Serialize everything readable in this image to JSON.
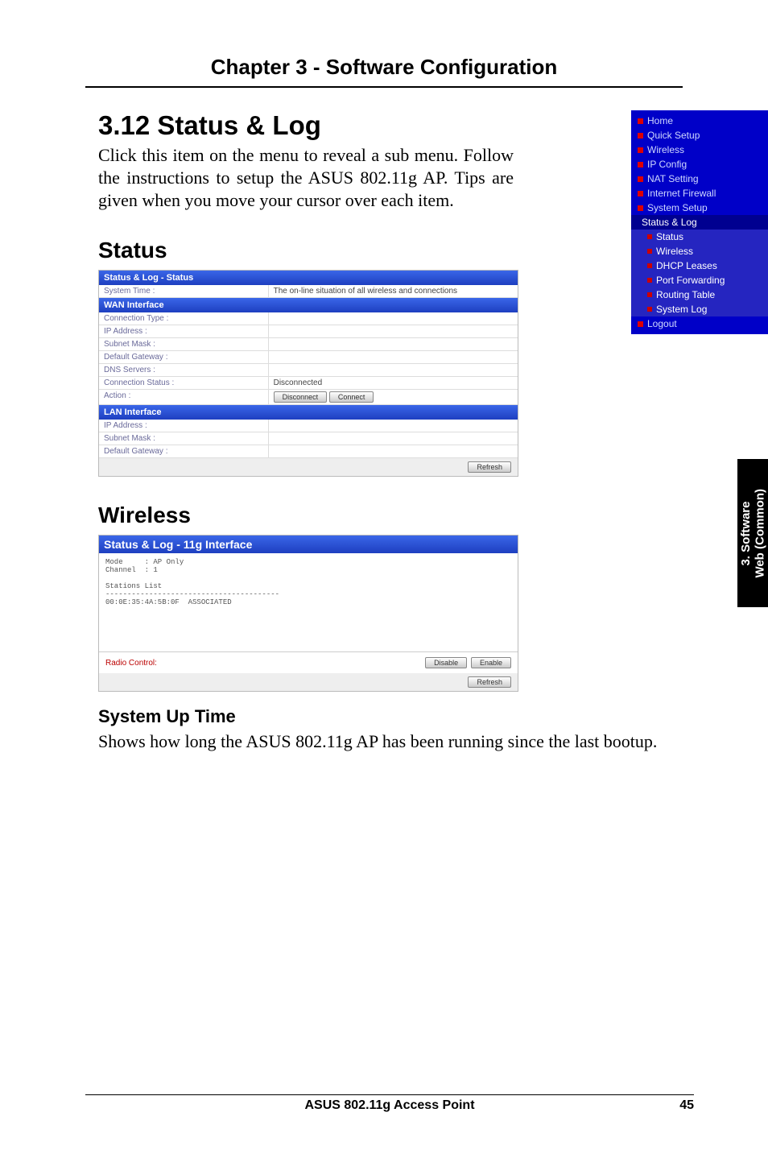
{
  "chapter_title": "Chapter 3 - Software Configuration",
  "section_title": "3.12  Status & Log",
  "intro": "Click this item on the menu to reveal a sub menu. Follow the instructions to setup the ASUS 802.11g AP. Tips are given when you move your cursor over each item.",
  "status_heading": "Status",
  "wireless_heading": "Wireless",
  "sys_uptime_heading": "System Up Time",
  "sys_uptime_body": "Shows how long the ASUS 802.11g AP has been running since the last bootup.",
  "side_tab_line1": "3. Software",
  "side_tab_line2": "Web (Common)",
  "footer_product": "ASUS 802.11g Access Point",
  "footer_page": "45",
  "blue_menu": {
    "items": [
      "Home",
      "Quick Setup",
      "Wireless",
      "IP Config",
      "NAT Setting",
      "Internet Firewall",
      "System Setup",
      "Status & Log"
    ],
    "subs": [
      "Status",
      "Wireless",
      "DHCP Leases",
      "Port Forwarding",
      "Routing Table",
      "System Log"
    ],
    "last": "Logout"
  },
  "status_table": {
    "title": "Status & Log - Status",
    "top_row_label": "System Time :",
    "top_row_value": "The on-line situation of all wireless and connections",
    "sec1": "WAN Interface",
    "rows1": [
      "Connection Type :",
      "IP Address :",
      "Subnet Mask :",
      "Default Gateway :",
      "DNS Servers :",
      "Connection Status :",
      "Action :"
    ],
    "conn_status_val": "Disconnected",
    "action_btn1": "Disconnect",
    "action_btn2": "Connect",
    "sec2": "LAN Interface",
    "rows2": [
      "IP Address :",
      "Subnet Mask :",
      "Default Gateway :"
    ],
    "refresh": "Refresh"
  },
  "wireless_table": {
    "title": "Status & Log - 11g Interface",
    "body_text": "Mode     : AP Only\nChannel  : 1\n\nStations List\n----------------------------------------\n00:0E:35:4A:5B:0F  ASSOCIATED",
    "radio_label": "Radio Control:",
    "btn_disable": "Disable",
    "btn_enable": "Enable",
    "refresh": "Refresh"
  }
}
